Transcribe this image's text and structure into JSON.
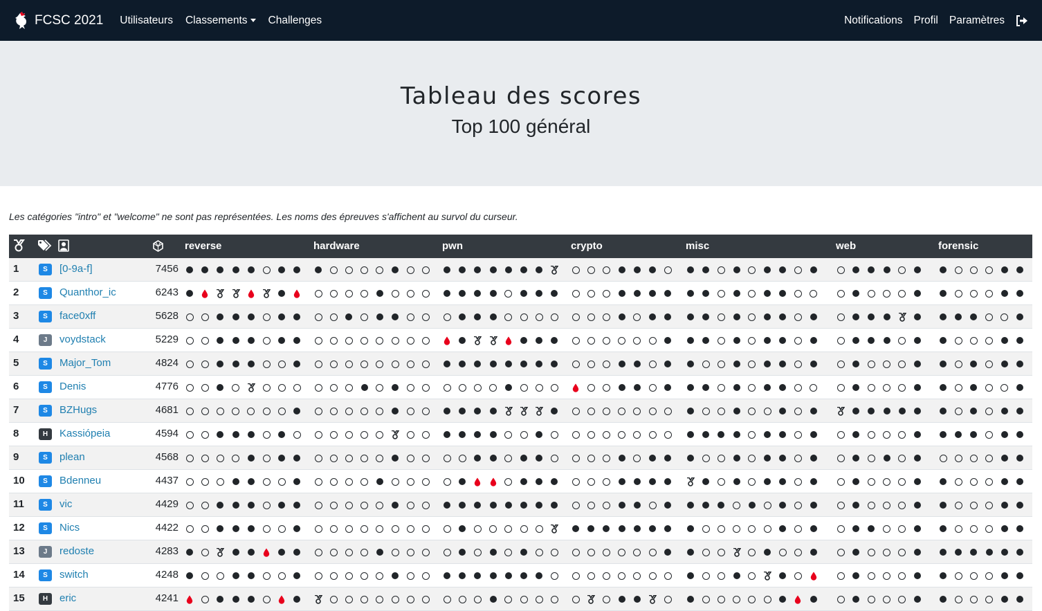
{
  "navbar": {
    "brand": "FCSC 2021",
    "links": [
      {
        "label": "Utilisateurs"
      },
      {
        "label": "Classements",
        "dropdown": true
      },
      {
        "label": "Challenges"
      }
    ],
    "right_links": [
      {
        "label": "Notifications"
      },
      {
        "label": "Profil"
      },
      {
        "label": "Paramètres"
      }
    ]
  },
  "header": {
    "title": "Tableau des scores",
    "subtitle": "Top 100 général"
  },
  "note": "Les catégories \"intro\" et \"welcome\" ne sont pas représentées. Les noms des épreuves s'affichent au survol du curseur.",
  "table": {
    "header_icons": [
      "medal-icon",
      "tags-icon",
      "user-icon",
      "score-icon"
    ],
    "categories": [
      {
        "name": "reverse",
        "count": 8
      },
      {
        "name": "hardware",
        "count": 8
      },
      {
        "name": "pwn",
        "count": 8
      },
      {
        "name": "crypto",
        "count": 7
      },
      {
        "name": "misc",
        "count": 9
      },
      {
        "name": "web",
        "count": 6
      },
      {
        "name": "forensic",
        "count": 6
      }
    ],
    "legend": {
      "F": "solved",
      "O": "unsolved",
      "M": "solved-medal",
      "B": "first-blood"
    },
    "rows": [
      {
        "rank": "1",
        "tag": "S",
        "name": "[0-9a-f]",
        "score": "7456",
        "cells": [
          "FFFFFOFF",
          "FOOOOFOO",
          "FFFFFFFM",
          "OOOFFFO",
          "FFOFOFFOF",
          "OFFFOF",
          "FOOOFF"
        ]
      },
      {
        "rank": "2",
        "tag": "S",
        "name": "Quanthor_ic",
        "score": "6243",
        "cells": [
          "FBMMBMFB",
          "OOOOFOOO",
          "FFFFOFFF",
          "OOOFFFF",
          "FFOFOFFOO",
          "OFOOOF",
          "FOOOFF"
        ]
      },
      {
        "rank": "3",
        "tag": "S",
        "name": "face0xff",
        "score": "5628",
        "cells": [
          "OOFFFOFF",
          "OOFOFFOO",
          "OFFFOOOO",
          "OOOFOFF",
          "FFOFOFFOF",
          "OFFFMF",
          "FFFOOF"
        ]
      },
      {
        "rank": "4",
        "tag": "J",
        "name": "voydstack",
        "score": "5229",
        "cells": [
          "OOFFFOFF",
          "OOOOOOOO",
          "BFMMBFFF",
          "OOOOOOF",
          "FFOFOFFOF",
          "OFFFOF",
          "FOOOFF"
        ]
      },
      {
        "rank": "5",
        "tag": "S",
        "name": "Major_Tom",
        "score": "4824",
        "cells": [
          "OOFFFOOF",
          "OOOOOOOO",
          "FFFFFFFF",
          "OOOFFOF",
          "FOOFOFFOF",
          "OFOOOF",
          "FOFOFF"
        ]
      },
      {
        "rank": "6",
        "tag": "S",
        "name": "Denis",
        "score": "4776",
        "cells": [
          "OOFOMOOO",
          "OOOFOFOO",
          "OOOOFOOO",
          "BOOFFOF",
          "FFOFOFFOO",
          "OFOOOF",
          "FOFOOF"
        ]
      },
      {
        "rank": "7",
        "tag": "S",
        "name": "BZHugs",
        "score": "4681",
        "cells": [
          "OOOOOOOF",
          "OOOOOFOO",
          "FFFFMMMF",
          "OOOOOOO",
          "FOOFOOFOF",
          "MFFFFF",
          "FOFOFF"
        ]
      },
      {
        "rank": "8",
        "tag": "H",
        "name": "Kassiópeia",
        "score": "4594",
        "cells": [
          "OOFFFOFO",
          "OOOOOMOO",
          "FFFFOOFO",
          "OOOOOOO",
          "FFFFOFFOF",
          "OFOOOF",
          "FFFOFF"
        ]
      },
      {
        "rank": "9",
        "tag": "S",
        "name": "plean",
        "score": "4568",
        "cells": [
          "OOOOFOFF",
          "OOOOOFOO",
          "OOFFOFFO",
          "OOOFOFF",
          "FOOFOFFOF",
          "OFOFOF",
          "OOOOFF"
        ]
      },
      {
        "rank": "10",
        "tag": "S",
        "name": "Bdenneu",
        "score": "4437",
        "cells": [
          "OOOFFOOF",
          "OOOOFOOO",
          "OFBBOFFF",
          "OOOFFFF",
          "MFOFOFFOF",
          "OFOOOF",
          "FOOOFF"
        ]
      },
      {
        "rank": "11",
        "tag": "S",
        "name": "vic",
        "score": "4429",
        "cells": [
          "OOFFFOFF",
          "OOOOOFOO",
          "FFFFFFFF",
          "OOOFFOF",
          "FFFOFOFOF",
          "OFOOOF",
          "FOOOFF"
        ]
      },
      {
        "rank": "12",
        "tag": "S",
        "name": "Nics",
        "score": "4422",
        "cells": [
          "OOFFFOOF",
          "OOOOOOOO",
          "OFOOOOOM",
          "FFFFFFF",
          "FOOOOOFOF",
          "OFFOOF",
          "FOOOFF"
        ]
      },
      {
        "rank": "13",
        "tag": "J",
        "name": "redoste",
        "score": "4283",
        "cells": [
          "FOMFFBFF",
          "OOOOFOOO",
          "OFOFOFOO",
          "OOOOOOF",
          "FOOMOFOOF",
          "OFOOOF",
          "FFFFFF"
        ]
      },
      {
        "rank": "14",
        "tag": "S",
        "name": "switch",
        "score": "4248",
        "cells": [
          "FOOFFOOF",
          "OOOOOFOO",
          "FFFFFFFO",
          "OOOOOOO",
          "FOOFOMFOB",
          "OFOOOF",
          "FOOOFF"
        ]
      },
      {
        "rank": "15",
        "tag": "H",
        "name": "eric",
        "score": "4241",
        "cells": [
          "BOFFFOBF",
          "MOOOOOOO",
          "OOOFOOOO",
          "OMOFFMO",
          "FOOOOOFBF",
          "OFOOOF",
          "FOOOFF"
        ]
      }
    ]
  },
  "colors": {
    "navbar_bg": "#0d1b2a",
    "jumbotron_bg": "#e9ecef",
    "table_header_bg": "#343a40",
    "link": "#1f7fb0",
    "badge_s": "#1e88e5",
    "badge_j": "#6c7a89",
    "badge_h": "#343a40",
    "blood": "#e8001c"
  }
}
